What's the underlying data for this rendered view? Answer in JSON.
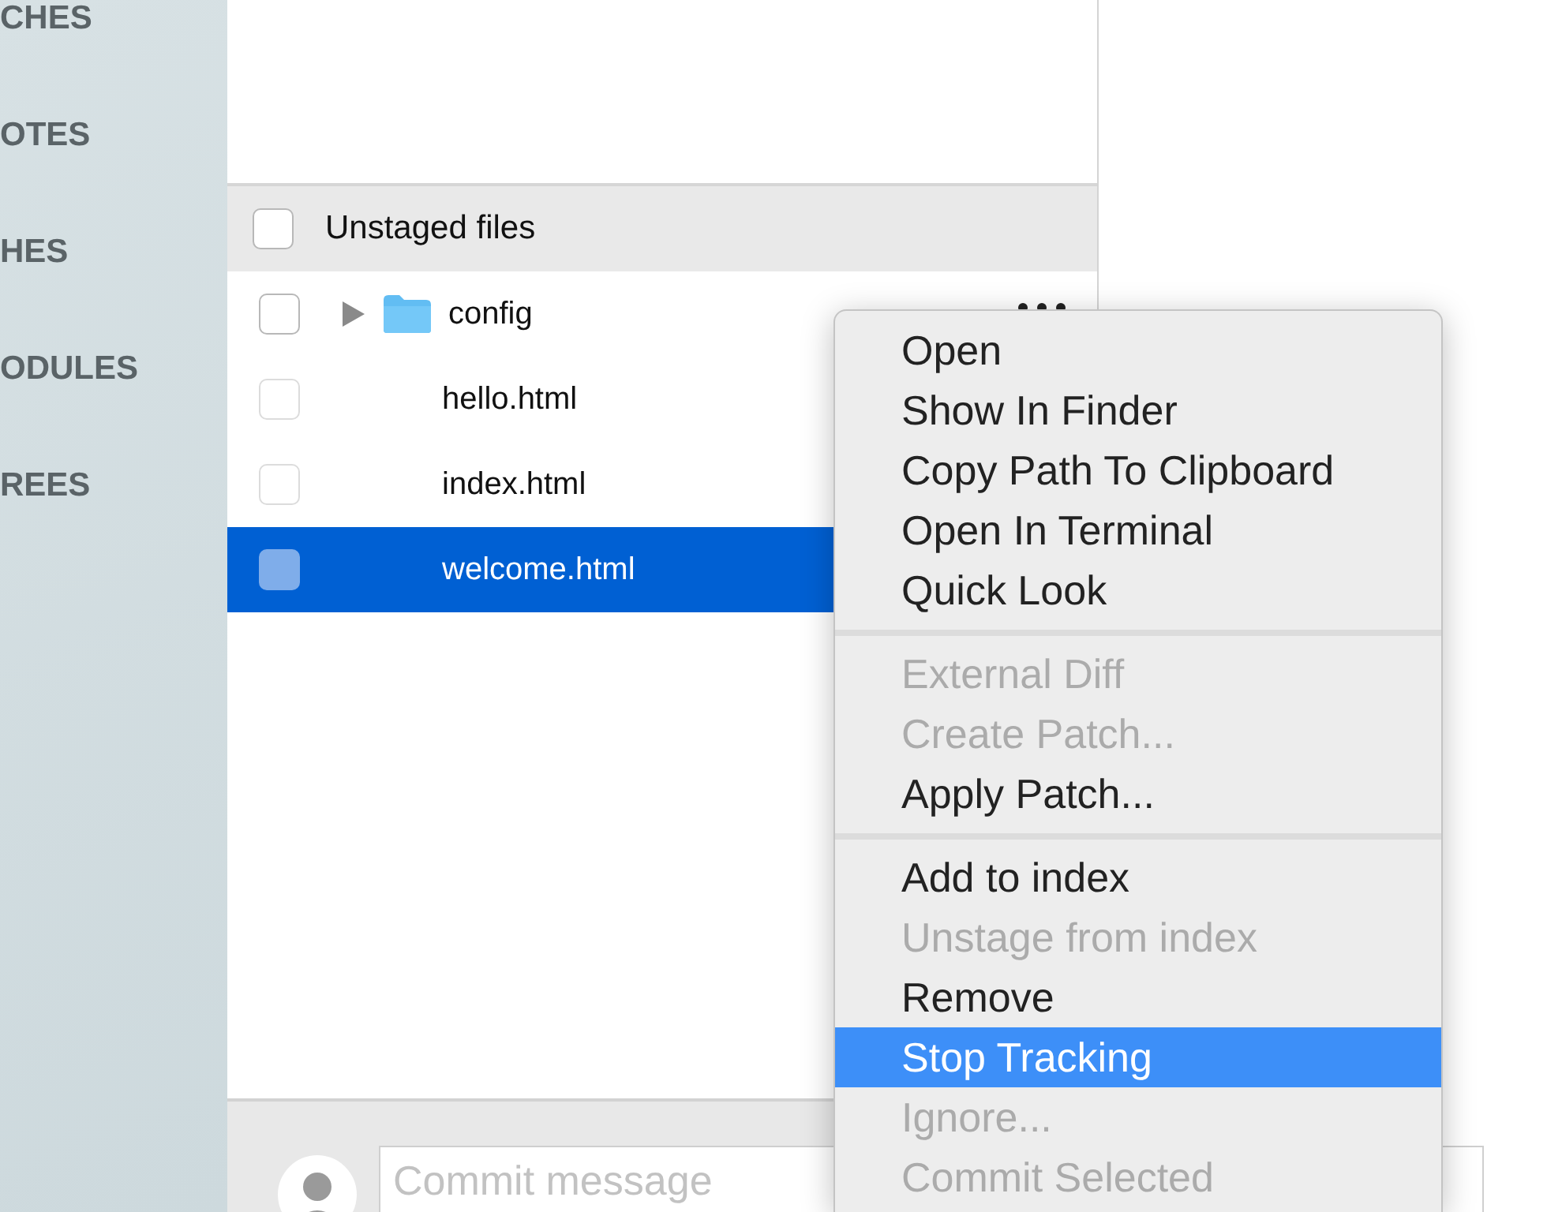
{
  "sidebar": {
    "sections": [
      "CHES",
      "OTES",
      "HES",
      "ODULES",
      "REES"
    ]
  },
  "unstaged": {
    "title": "Unstaged files",
    "checked": false,
    "files": [
      {
        "name": "config",
        "kind": "folder",
        "checked": false,
        "selected": false
      },
      {
        "name": "hello.html",
        "kind": "file",
        "checked": false,
        "selected": false
      },
      {
        "name": "index.html",
        "kind": "file",
        "checked": false,
        "selected": false
      },
      {
        "name": "welcome.html",
        "kind": "file",
        "checked": false,
        "selected": true
      }
    ]
  },
  "context_menu": {
    "groups": [
      [
        {
          "label": "Open",
          "disabled": false,
          "selected": false
        },
        {
          "label": "Show In Finder",
          "disabled": false,
          "selected": false
        },
        {
          "label": "Copy Path To Clipboard",
          "disabled": false,
          "selected": false
        },
        {
          "label": "Open In Terminal",
          "disabled": false,
          "selected": false
        },
        {
          "label": "Quick Look",
          "disabled": false,
          "selected": false
        }
      ],
      [
        {
          "label": "External Diff",
          "disabled": true,
          "selected": false
        },
        {
          "label": "Create Patch...",
          "disabled": true,
          "selected": false
        },
        {
          "label": "Apply Patch...",
          "disabled": false,
          "selected": false
        }
      ],
      [
        {
          "label": "Add to index",
          "disabled": false,
          "selected": false
        },
        {
          "label": "Unstage from index",
          "disabled": true,
          "selected": false
        },
        {
          "label": "Remove",
          "disabled": false,
          "selected": false
        },
        {
          "label": "Stop Tracking",
          "disabled": false,
          "selected": true
        },
        {
          "label": "Ignore...",
          "disabled": true,
          "selected": false
        },
        {
          "label": "Commit Selected",
          "disabled": true,
          "selected": false
        }
      ]
    ]
  },
  "commit": {
    "placeholder": "Commit message"
  }
}
